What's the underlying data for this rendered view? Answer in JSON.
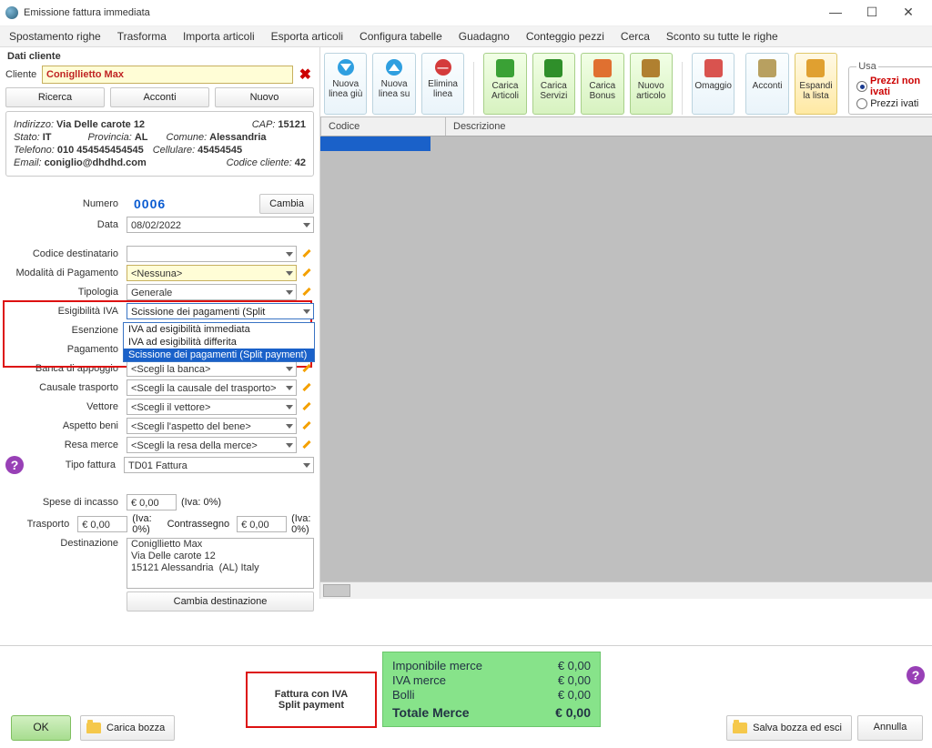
{
  "window": {
    "title": "Emissione fattura immediata"
  },
  "menu": [
    "Spostamento righe",
    "Trasforma",
    "Importa articoli",
    "Esporta articoli",
    "Configura tabelle",
    "Guadagno",
    "Conteggio pezzi",
    "Cerca",
    "Sconto su tutte le righe"
  ],
  "toolbar": {
    "nuova_linea_giu": "Nuova linea giù",
    "nuova_linea_su": "Nuova linea su",
    "elimina_linea": "Elimina linea",
    "carica_articoli": "Carica Articoli",
    "carica_servizi": "Carica Servizi",
    "carica_bonus": "Carica Bonus",
    "nuovo_articolo": "Nuovo articolo",
    "omaggio": "Omaggio",
    "acconti": "Acconti",
    "espandi": "Espandi la lista"
  },
  "usa": {
    "legend": "Usa",
    "opt1": "Prezzi non ivati",
    "opt2": "Prezzi ivati"
  },
  "grid": {
    "col_codice": "Codice",
    "col_descrizione": "Descrizione"
  },
  "client": {
    "section": "Dati cliente",
    "label": "Cliente",
    "name": "Conigllietto Max",
    "ricerca": "Ricerca",
    "acconti": "Acconti",
    "nuovo": "Nuovo",
    "indirizzo_l": "Indirizzo:",
    "indirizzo": "Via Delle carote 12",
    "cap_l": "CAP:",
    "cap": "15121",
    "stato_l": "Stato:",
    "stato": "IT",
    "provincia_l": "Provincia:",
    "provincia": "AL",
    "comune_l": "Comune:",
    "comune": "Alessandria",
    "tel_l": "Telefono:",
    "tel": "010 454545454545",
    "cell_l": "Cellulare:",
    "cell": "45454545",
    "email_l": "Email:",
    "email": "coniglio@dhdhd.com",
    "codcli_l": "Codice cliente:",
    "codcli": "42"
  },
  "form": {
    "numero_l": "Numero",
    "numero": "0006",
    "cambia": "Cambia",
    "data_l": "Data",
    "data": "08/02/2022",
    "coddest_l": "Codice destinatario",
    "coddest": "",
    "modpag_l": "Modalità di Pagamento",
    "modpag": "<Nessuna>",
    "tipologia_l": "Tipologia",
    "tipologia": "Generale",
    "esigiva_l": "Esigibilità IVA",
    "esigiva": "Scissione dei pagamenti (Split payment)",
    "esigiva_opts": [
      "IVA ad esigibilità immediata",
      "IVA ad esigibilità differita",
      "Scissione dei pagamenti (Split payment)"
    ],
    "esenzione_l": "Esenzione",
    "pagamento_l": "Pagamento",
    "banca_l": "Banca di appoggio",
    "banca": "<Scegli la banca>",
    "causale_l": "Causale trasporto",
    "causale": "<Scegli la causale del trasporto>",
    "vettore_l": "Vettore",
    "vettore": "<Scegli il vettore>",
    "aspetto_l": "Aspetto beni",
    "aspetto": "<Scegli l'aspetto del bene>",
    "resa_l": "Resa merce",
    "resa": "<Scegli la resa della merce>",
    "tipofat_l": "Tipo fattura",
    "tipofat": "TD01 Fattura",
    "spese_l": "Spese di incasso",
    "spese": "€ 0,00",
    "iva_hint": "(Iva: 0%)",
    "trasporto_l": "Trasporto",
    "trasporto": "€ 0,00",
    "contrassegno_l": "Contrassegno",
    "contrassegno": "€ 0,00",
    "dest_l": "Destinazione",
    "dest": "Conigllietto Max\nVia Delle carote 12\n15121 Alessandria  (AL) Italy",
    "cambia_dest": "Cambia destinazione"
  },
  "totals": {
    "imponibile_l": "Imponibile merce",
    "imponibile": "€ 0,00",
    "iva_l": "IVA merce",
    "iva": "€ 0,00",
    "bolli_l": "Bolli",
    "bolli": "€ 0,00",
    "totale_l": "Totale Merce",
    "totale": "€ 0,00"
  },
  "iva_note": "Fattura con IVA\nSplit payment",
  "buttons": {
    "ok": "OK",
    "carica_bozza": "Carica bozza",
    "salva_bozza": "Salva bozza ed esci",
    "annulla": "Annulla"
  }
}
